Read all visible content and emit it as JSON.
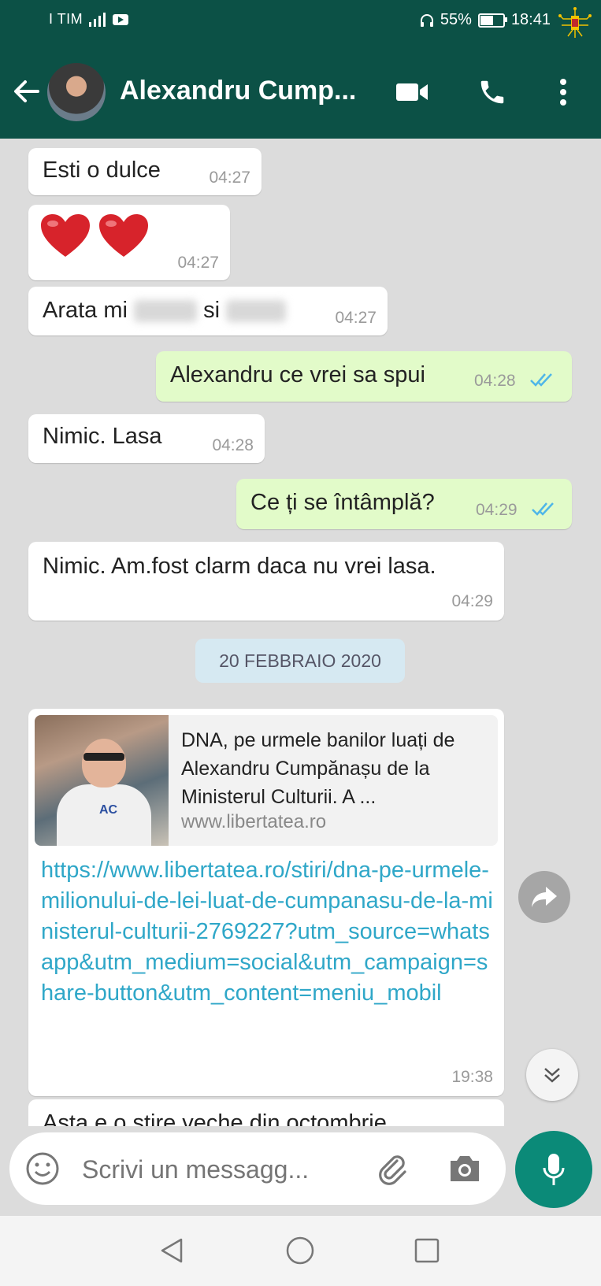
{
  "status_bar": {
    "carrier": "I TIM",
    "battery_percent": "55%",
    "battery_level": 0.55,
    "time": "18:41"
  },
  "header": {
    "contact_name": "Alexandru Cump...",
    "icons": [
      "back-arrow-icon",
      "video-call-icon",
      "phone-icon",
      "more-vert-icon"
    ]
  },
  "messages": [
    {
      "direction": "in",
      "text": "Esti o dulce",
      "time": "04:27"
    },
    {
      "direction": "in",
      "text": "❤️❤️",
      "time": "04:27"
    },
    {
      "direction": "in",
      "text_parts": [
        "Arata mi",
        "si"
      ],
      "time": "04:27"
    },
    {
      "direction": "out",
      "text": "Alexandru ce vrei sa spui",
      "time": "04:28",
      "read": true
    },
    {
      "direction": "in",
      "text": "Nimic. Lasa",
      "time": "04:28"
    },
    {
      "direction": "out",
      "text": "Ce ți se întâmplă?",
      "time": "04:29",
      "read": true
    },
    {
      "direction": "in",
      "text": "Nimic. Am.fost clarm daca nu vrei lasa.",
      "time": "04:29"
    }
  ],
  "date_separator": "20 FEBBRAIO 2020",
  "link_message": {
    "preview_title": "DNA, pe urmele banilor luați de Alexandru Cumpănașu de la Ministerul Culturii. A ...",
    "preview_domain": "www.libertatea.ro",
    "url": "https://www.libertatea.ro/stiri/dna-pe-urmele-milionului-de-lei-luat-de-cumpanasu-de-la-ministerul-culturii-2769227?utm_source=whatsapp&utm_medium=social&utm_campaign=share-button&utm_content=meniu_mobil",
    "time": "19:38",
    "thumbnail_text": "AC"
  },
  "partial_message": {
    "text": "Asta e o stire veche din octombrie"
  },
  "composer": {
    "placeholder": "Scrivi un messagg..."
  },
  "colors": {
    "header_bg": "#0c5146",
    "outgoing_bubble": "#e2fbc9",
    "link": "#2fa7c8",
    "mic_button": "#0b8a78"
  }
}
